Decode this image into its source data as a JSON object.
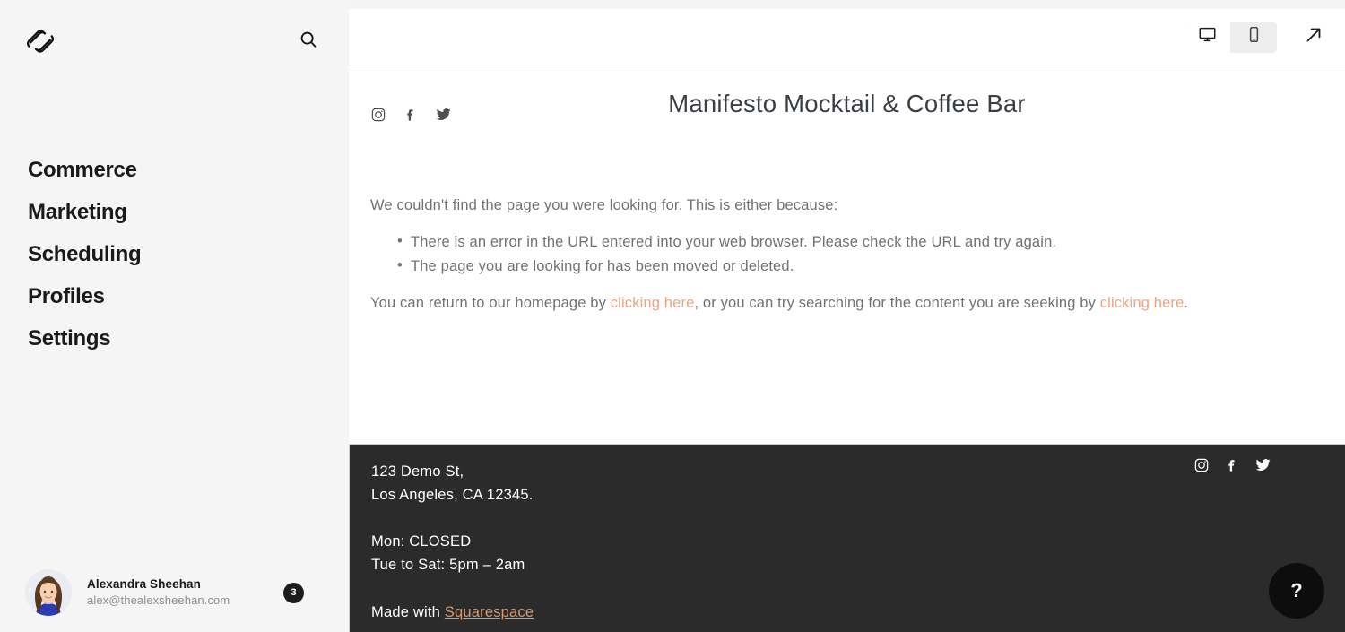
{
  "sidebar": {
    "logo_icon": "squarespace-logo",
    "search_icon": "search-icon",
    "nav_items": [
      {
        "label": "Commerce"
      },
      {
        "label": "Marketing"
      },
      {
        "label": "Scheduling"
      },
      {
        "label": "Profiles"
      },
      {
        "label": "Settings"
      }
    ],
    "user": {
      "name": "Alexandra Sheehan",
      "email": "alex@thealexsheehan.com",
      "notification_count": "3",
      "avatar_icon": "user-avatar-photo"
    }
  },
  "preview": {
    "toolbar": {
      "desktop_icon": "desktop-monitor-icon",
      "mobile_icon": "mobile-phone-icon",
      "external_link_icon": "external-link-arrow-icon",
      "active_device": "desktop"
    },
    "site": {
      "title": "Manifesto Mocktail & Coffee Bar",
      "header_social": [
        {
          "icon": "instagram-icon"
        },
        {
          "icon": "facebook-icon"
        },
        {
          "icon": "twitter-icon"
        }
      ],
      "intro": "We couldn't find the page you were looking for. This is either because:",
      "reasons": [
        "There is an error in the URL entered into your web browser. Please check the URL and try again.",
        "The page you are looking for has been moved or deleted."
      ],
      "closing": {
        "part1": "You can return to our homepage by ",
        "link1": "clicking here",
        "part2": ", or you can try searching for the content you are seeking by ",
        "link2": "clicking here",
        "part3": "."
      },
      "footer": {
        "address_line1": "123 Demo St,",
        "address_line2": "Los Angeles, CA 12345.",
        "hours_line1": "Mon: CLOSED",
        "hours_line2": "Tue to Sat: 5pm – 2am",
        "credit_prefix": "Made with ",
        "credit_link": "Squarespace",
        "social": [
          {
            "icon": "instagram-icon"
          },
          {
            "icon": "facebook-icon"
          },
          {
            "icon": "twitter-icon"
          }
        ]
      }
    }
  },
  "help": {
    "label": "?",
    "icon": "question-mark-icon"
  },
  "colors": {
    "sidebar_bg": "#f5f5f5",
    "link_accent": "#e8a685",
    "footer_bg": "#2b2b2b",
    "footer_link": "#d79a72",
    "text_dark": "#1a1a1a",
    "body_text": "#6f7276"
  }
}
